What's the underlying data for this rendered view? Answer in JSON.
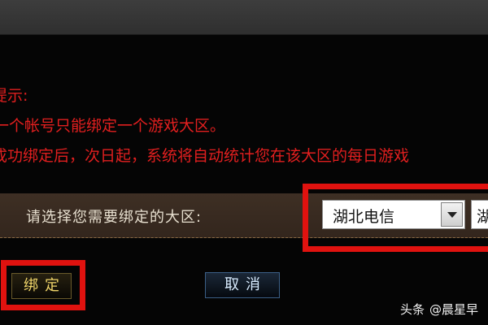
{
  "notice": {
    "title": "提示:",
    "line1": "一个帐号只能绑定一个游戏大区。",
    "line2": "成功绑定后，次日起，系统将自动统计您在该大区的每日游戏"
  },
  "region_select": {
    "label": "请选择您需要绑定的大区:",
    "selected_value": "湖北电信",
    "second_value": "湖"
  },
  "buttons": {
    "bind_label": "绑定",
    "cancel_label": "取消"
  },
  "watermark": {
    "source": "头条",
    "author": "@晨星早"
  },
  "colors": {
    "notice_text": "#e21f1f",
    "highlight_box": "#e0120f"
  }
}
